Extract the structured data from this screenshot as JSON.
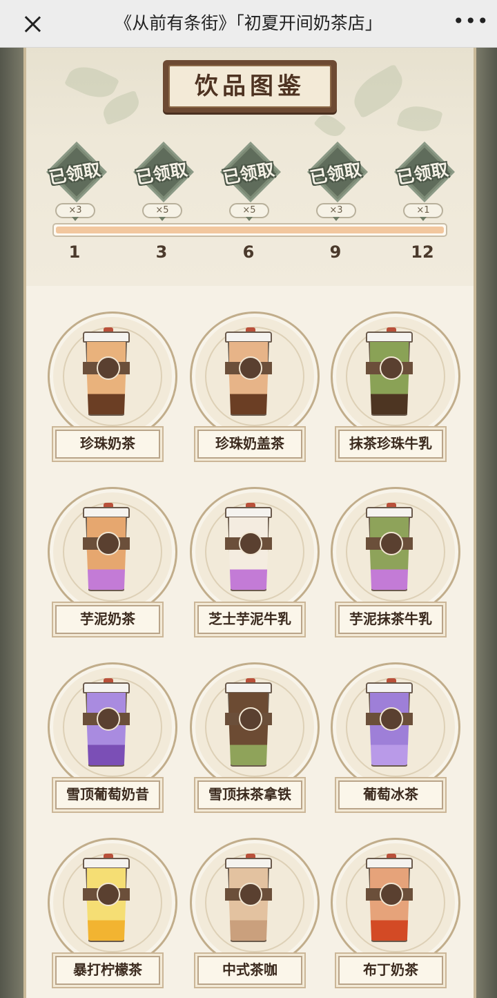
{
  "window": {
    "title": "《从前有条街》「初夏开间奶茶店」",
    "close_icon": "close-icon",
    "more_icon": "more-dots-icon",
    "more_glyph": "•••"
  },
  "header": {
    "title": "饮品图鉴"
  },
  "rewards": [
    {
      "status": "已领取",
      "count": "×3",
      "milestone": "1"
    },
    {
      "status": "已领取",
      "count": "×5",
      "milestone": "3"
    },
    {
      "status": "已领取",
      "count": "×5",
      "milestone": "6"
    },
    {
      "status": "已领取",
      "count": "×3",
      "milestone": "9"
    },
    {
      "status": "已领取",
      "count": "×1",
      "milestone": "12"
    }
  ],
  "progress": {
    "fraction": 1.0
  },
  "drinks": [
    {
      "name": "珍珠奶茶",
      "liquid": "#e9b27c",
      "topping": "#6b3e24"
    },
    {
      "name": "珍珠奶盖茶",
      "liquid": "#e7b488",
      "topping": "#6b3e24"
    },
    {
      "name": "抹茶珍珠牛乳",
      "liquid": "#8aa256",
      "topping": "#4d3522"
    },
    {
      "name": "芋泥奶茶",
      "liquid": "#e6a76f",
      "topping": "#c37bd6"
    },
    {
      "name": "芝士芋泥牛乳",
      "liquid": "#f4ece0",
      "topping": "#c37bd6"
    },
    {
      "name": "芋泥抹茶牛乳",
      "liquid": "#8ea35a",
      "topping": "#c37bd6"
    },
    {
      "name": "雪顶葡萄奶昔",
      "liquid": "#a98be0",
      "topping": "#7b4fb6"
    },
    {
      "name": "雪顶抹茶拿铁",
      "liquid": "#6c4b33",
      "topping": "#8fa35a"
    },
    {
      "name": "葡萄冰茶",
      "liquid": "#9e7fd8",
      "topping": "#b99ae8"
    },
    {
      "name": "暴打柠檬茶",
      "liquid": "#f5de74",
      "topping": "#f2b431"
    },
    {
      "name": "中式茶咖",
      "liquid": "#e3c2a0",
      "topping": "#caa07d"
    },
    {
      "name": "布丁奶茶",
      "liquid": "#e6a37a",
      "topping": "#d34a25"
    }
  ]
}
